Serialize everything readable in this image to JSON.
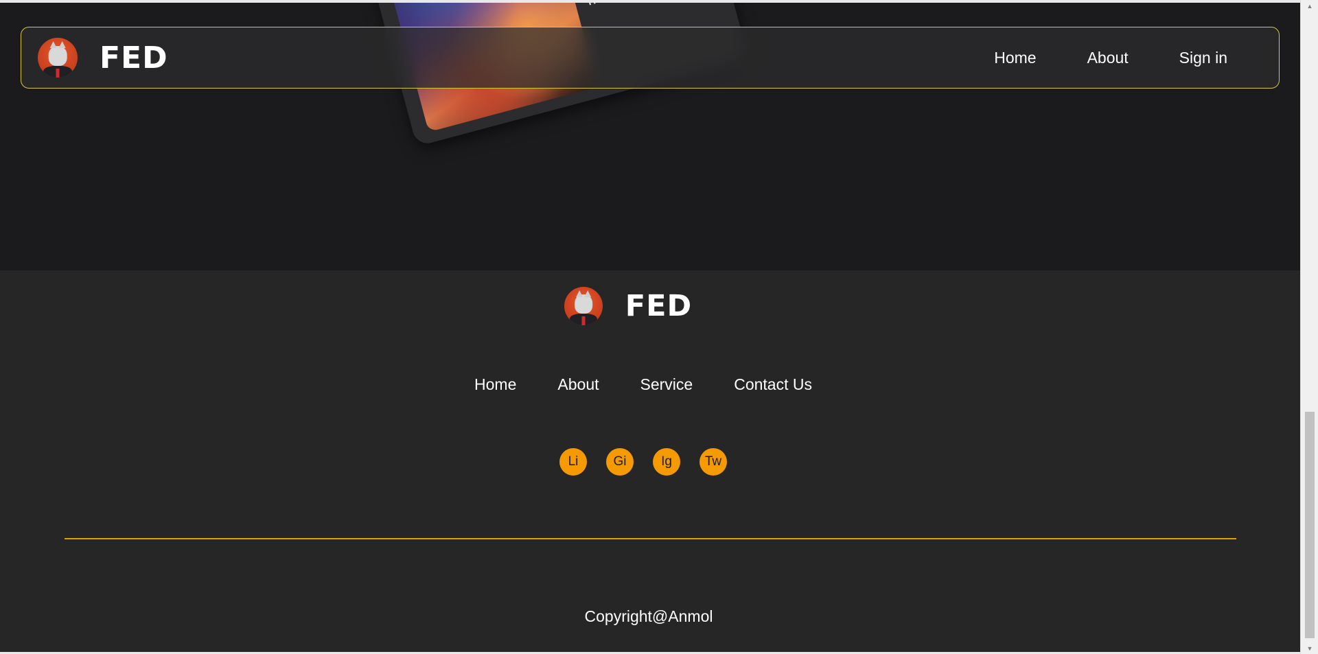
{
  "brand": {
    "name": "FED"
  },
  "hero": {
    "card_text": "ut labore et dolore magna"
  },
  "navbar": {
    "links": [
      "Home",
      "About",
      "Sign in"
    ]
  },
  "footer": {
    "brand_name": "FED",
    "links": [
      "Home",
      "About",
      "Service",
      "Contact Us"
    ],
    "socials": [
      "Li",
      "Gi",
      "Ig",
      "Tw"
    ],
    "copyright": "Copyright@Anmol"
  },
  "colors": {
    "accent": "#f59a00",
    "navbar_border": "#d9c640",
    "divider": "#e1a100",
    "background": "#1b1b1d",
    "footer_background": "#262626"
  },
  "icons": [
    "wolf-avatar-logo-icon",
    "scroll-up-icon",
    "scroll-down-icon"
  ]
}
